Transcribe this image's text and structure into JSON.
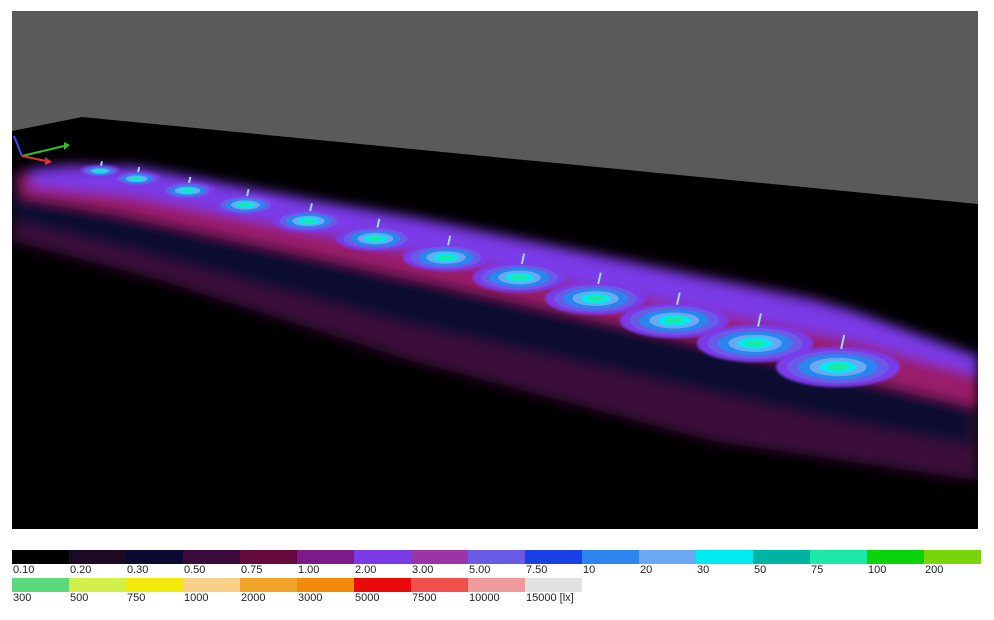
{
  "scene": {
    "background_color": "#000000",
    "wall_color": "#5a5a5a",
    "luminaire_count": 12,
    "axis_colors": {
      "x": "#e03030",
      "y": "#30c030",
      "z": "#4040ff"
    }
  },
  "legend": {
    "unit": "[lx]",
    "row1": [
      {
        "label": "0.10",
        "color": "#000000"
      },
      {
        "label": "0.20",
        "color": "#1c0a22"
      },
      {
        "label": "0.30",
        "color": "#0b0a33"
      },
      {
        "label": "0.50",
        "color": "#3a0a3a"
      },
      {
        "label": "0.75",
        "color": "#640a3c"
      },
      {
        "label": "1.00",
        "color": "#7c1a8a"
      },
      {
        "label": "2.00",
        "color": "#7a3ae8"
      },
      {
        "label": "3.00",
        "color": "#9a35a8"
      },
      {
        "label": "5.00",
        "color": "#6a5ae8"
      },
      {
        "label": "7.50",
        "color": "#1a40e8"
      },
      {
        "label": "10",
        "color": "#2a86ee"
      },
      {
        "label": "20",
        "color": "#6aa8f2"
      },
      {
        "label": "30",
        "color": "#00eaf2"
      },
      {
        "label": "50",
        "color": "#00b4a4"
      },
      {
        "label": "75",
        "color": "#1ae8a4"
      },
      {
        "label": "100",
        "color": "#0ad40a"
      },
      {
        "label": "200",
        "color": "#7ad40a"
      }
    ],
    "row2": [
      {
        "label": "300",
        "color": "#5ada7a"
      },
      {
        "label": "500",
        "color": "#d2f04a"
      },
      {
        "label": "750",
        "color": "#f2ea0a"
      },
      {
        "label": "1000",
        "color": "#f8d08a"
      },
      {
        "label": "2000",
        "color": "#f2a42a"
      },
      {
        "label": "3000",
        "color": "#f28a0a"
      },
      {
        "label": "5000",
        "color": "#ea0a0a"
      },
      {
        "label": "7500",
        "color": "#f0504a"
      },
      {
        "label": "10000",
        "color": "#f09a9a"
      },
      {
        "label": "15000",
        "color": "#e2e2e2"
      }
    ]
  }
}
